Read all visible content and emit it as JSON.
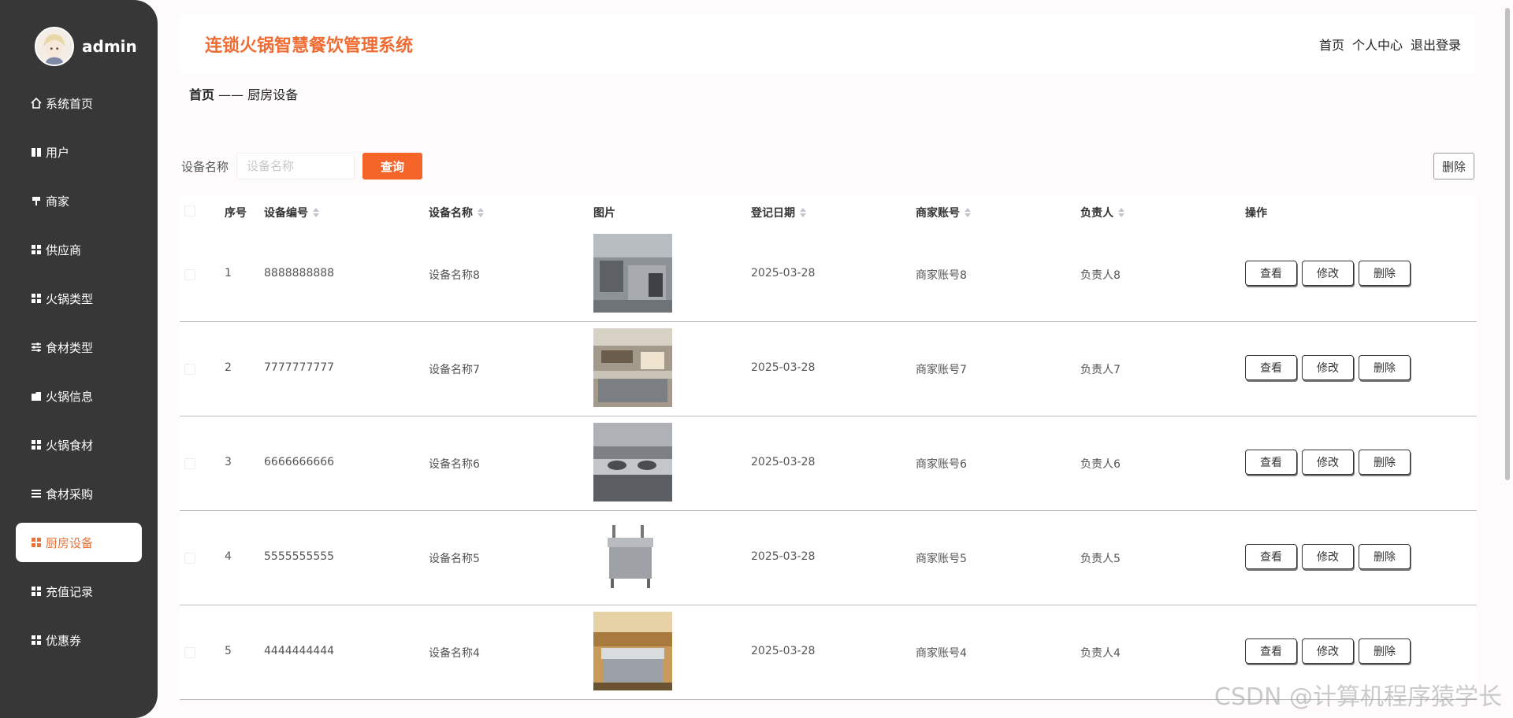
{
  "user": {
    "name": "admin"
  },
  "sidebar": {
    "items": [
      {
        "label": "系统首页",
        "icon": "home-icon"
      },
      {
        "label": "用户",
        "icon": "book-icon"
      },
      {
        "label": "商家",
        "icon": "pin-icon"
      },
      {
        "label": "供应商",
        "icon": "grid-icon"
      },
      {
        "label": "火锅类型",
        "icon": "grid-icon"
      },
      {
        "label": "食材类型",
        "icon": "sliders-icon"
      },
      {
        "label": "火锅信息",
        "icon": "folder-icon"
      },
      {
        "label": "火锅食材",
        "icon": "grid-icon"
      },
      {
        "label": "食材采购",
        "icon": "list-icon"
      },
      {
        "label": "厨房设备",
        "icon": "grid-icon",
        "active": true
      },
      {
        "label": "充值记录",
        "icon": "grid-icon"
      },
      {
        "label": "优惠券",
        "icon": "grid-icon"
      }
    ]
  },
  "header": {
    "title": "连锁火锅智慧餐饮管理系统",
    "links": [
      "首页",
      "个人中心",
      "退出登录"
    ]
  },
  "breadcrumb": {
    "home": "首页",
    "separator": "——",
    "current": "厨房设备"
  },
  "search": {
    "label": "设备名称",
    "placeholder": "设备名称",
    "query_button": "查询",
    "delete_button": "删除"
  },
  "table": {
    "headers": {
      "index": "序号",
      "code": "设备编号",
      "name": "设备名称",
      "image": "图片",
      "date": "登记日期",
      "merchant": "商家账号",
      "owner": "负责人",
      "ops": "操作"
    },
    "ops": {
      "view": "查看",
      "edit": "修改",
      "delete": "删除"
    },
    "rows": [
      {
        "index": "1",
        "code": "8888888888",
        "name": "设备名称8",
        "date": "2025-03-28",
        "merchant": "商家账号8",
        "owner": "负责人8"
      },
      {
        "index": "2",
        "code": "7777777777",
        "name": "设备名称7",
        "date": "2025-03-28",
        "merchant": "商家账号7",
        "owner": "负责人7"
      },
      {
        "index": "3",
        "code": "6666666666",
        "name": "设备名称6",
        "date": "2025-03-28",
        "merchant": "商家账号6",
        "owner": "负责人6"
      },
      {
        "index": "4",
        "code": "5555555555",
        "name": "设备名称5",
        "date": "2025-03-28",
        "merchant": "商家账号5",
        "owner": "负责人5"
      },
      {
        "index": "5",
        "code": "4444444444",
        "name": "设备名称4",
        "date": "2025-03-28",
        "merchant": "商家账号4",
        "owner": "负责人4"
      }
    ]
  },
  "watermark": "CSDN @计算机程序猿学长",
  "colors": {
    "accent": "#f5652a",
    "title": "#ef6c33",
    "sidebar": "#373737"
  }
}
